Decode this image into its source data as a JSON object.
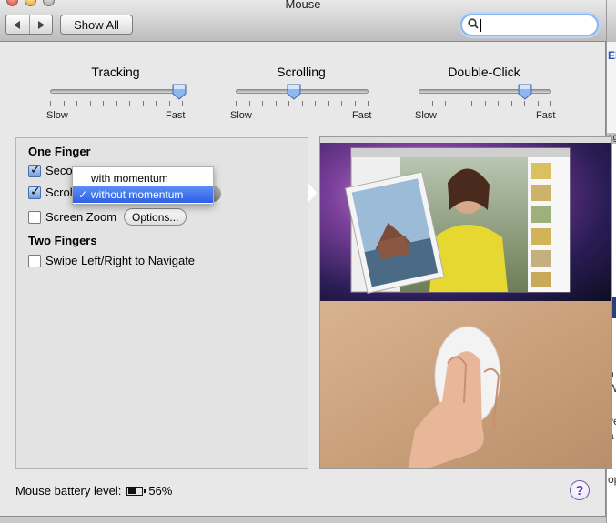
{
  "window": {
    "title": "Mouse"
  },
  "toolbar": {
    "back_icon": "chevron-left-icon",
    "forward_icon": "chevron-right-icon",
    "show_all_label": "Show All",
    "search_value": "",
    "search_placeholder": ""
  },
  "sliders": [
    {
      "label": "Tracking",
      "min_label": "Slow",
      "max_label": "Fast",
      "value_fraction": 0.97
    },
    {
      "label": "Scrolling",
      "min_label": "Slow",
      "max_label": "Fast",
      "value_fraction": 0.44
    },
    {
      "label": "Double-Click",
      "min_label": "Slow",
      "max_label": "Fast",
      "value_fraction": 0.8
    }
  ],
  "one_finger": {
    "heading": "One Finger",
    "secondary_click": {
      "label": "Seco",
      "checked": true
    },
    "scroll": {
      "label": "Scrol",
      "checked": true
    },
    "screen_zoom": {
      "label": "Screen Zoom",
      "checked": false,
      "options_label": "Options..."
    }
  },
  "two_fingers": {
    "heading": "Two Fingers",
    "swipe": {
      "label": "Swipe Left/Right to Navigate",
      "checked": false
    }
  },
  "scroll_menu": {
    "options": [
      "with momentum",
      "without momentum"
    ],
    "selected": "without momentum",
    "check_mark": "✓"
  },
  "battery": {
    "label": "Mouse battery level:",
    "value": "56%",
    "level_fraction": 0.56
  },
  "help": {
    "label": "?"
  },
  "background_window": {
    "fragments": [
      "ERI",
      "age",
      "n",
      "WI",
      "ve",
      "a",
      "op"
    ]
  },
  "colors": {
    "accent": "#3a6ff0",
    "selection": "#2d5fe6",
    "help": "#5e3fc2"
  }
}
